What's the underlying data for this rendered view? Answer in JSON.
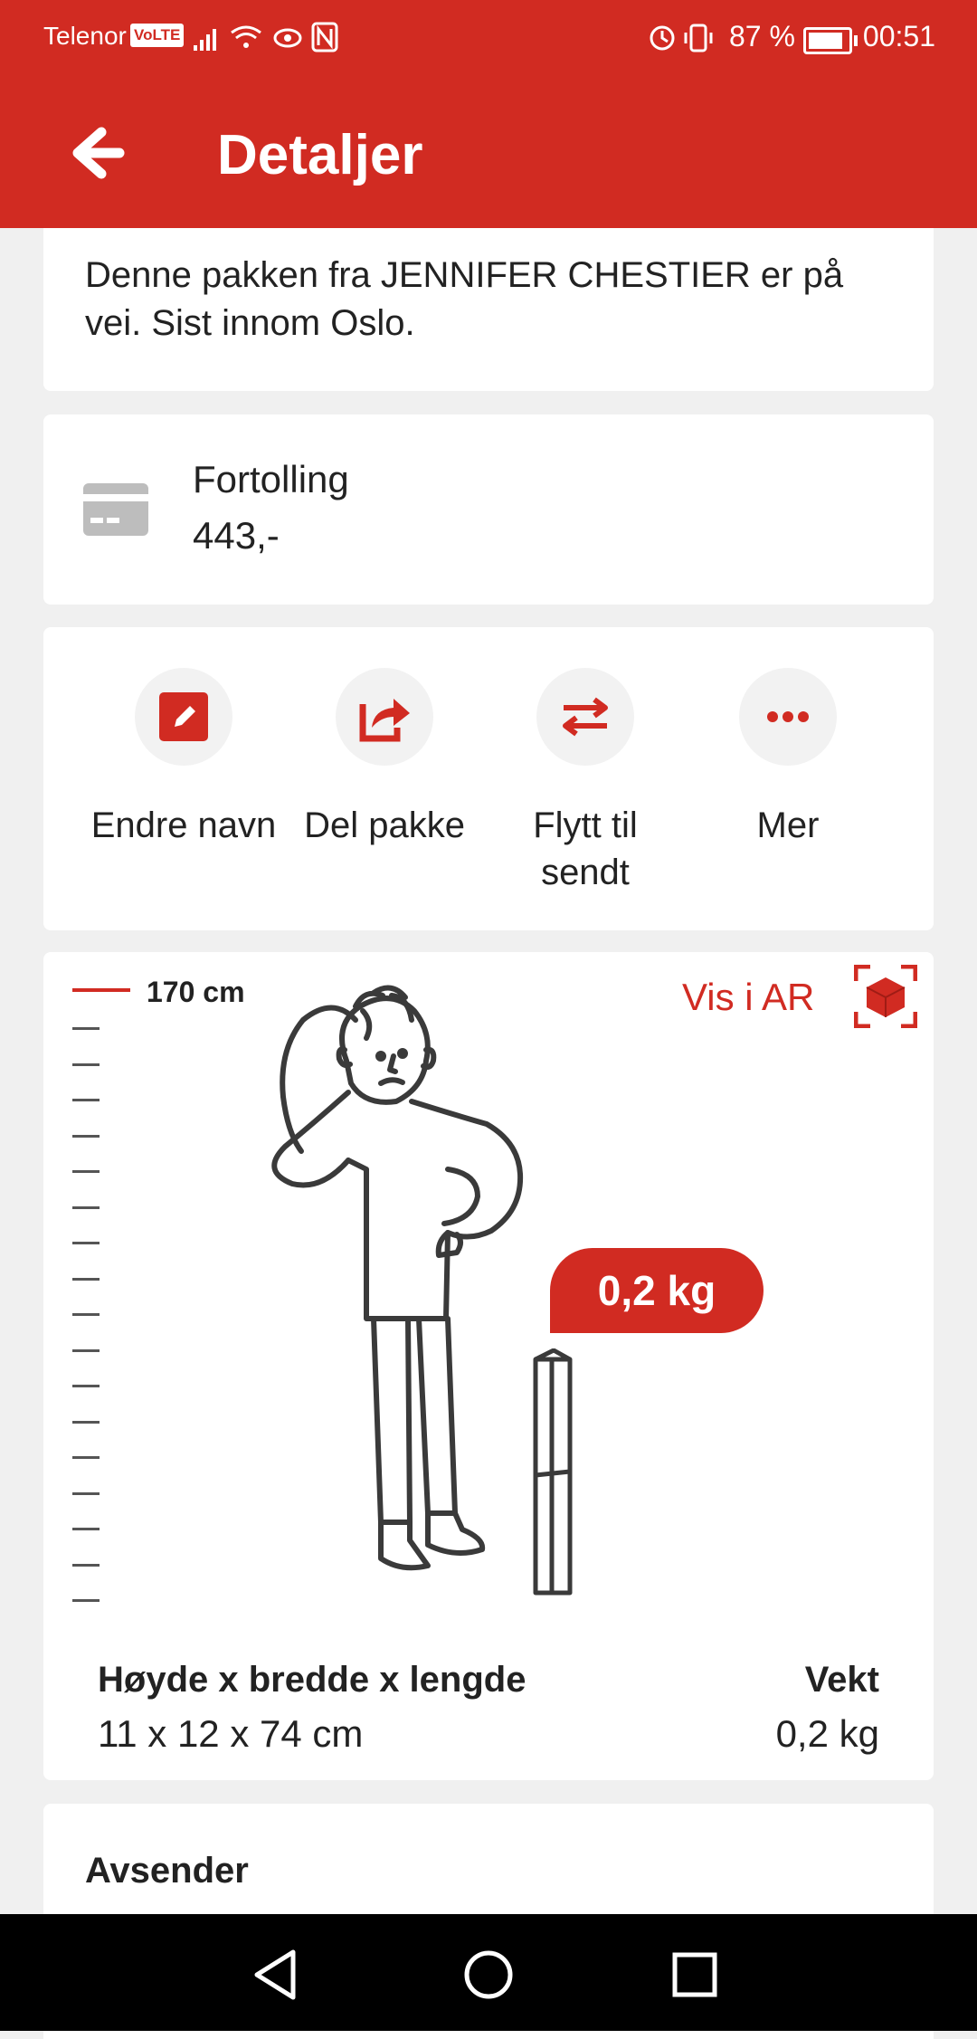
{
  "status_bar": {
    "carrier": "Telenor",
    "volte": "VoLTE",
    "battery_pct": "87 %",
    "time": "00:51"
  },
  "app_bar": {
    "title": "Detaljer",
    "back_icon": "arrow-left-icon"
  },
  "summary": {
    "text": "Denne pakken fra JENNIFER CHESTIER er på vei. Sist innom Oslo."
  },
  "customs": {
    "icon": "credit-card-icon",
    "label": "Fortolling",
    "value": "443,-"
  },
  "actions": [
    {
      "label": "Endre navn",
      "icon": "edit-icon"
    },
    {
      "label": "Del pakke",
      "icon": "share-icon"
    },
    {
      "label": "Flytt til sendt",
      "icon": "swap-arrows-icon"
    },
    {
      "label": "Mer",
      "icon": "more-dots-icon"
    }
  ],
  "size_visual": {
    "height_label": "170 cm",
    "ar_label": "Vis i AR",
    "weight_bubble": "0,2 kg",
    "dimensions_heading": "Høyde x bredde x lengde",
    "dimensions_value": "11 x 12 x 74 cm",
    "weight_heading": "Vekt",
    "weight_value": "0,2 kg"
  },
  "sender": {
    "heading": "Avsender"
  },
  "colors": {
    "brand_red": "#d12b22",
    "background": "#f0f0f0",
    "card": "#ffffff"
  }
}
